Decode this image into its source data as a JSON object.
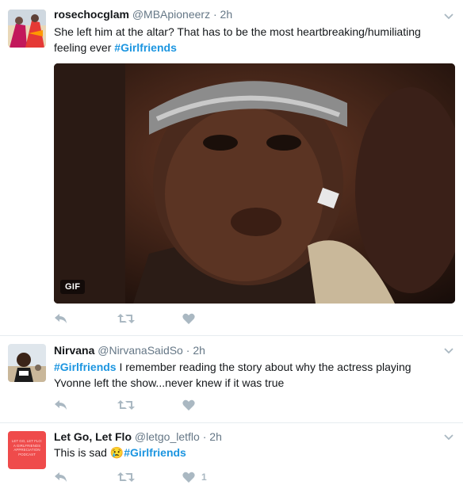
{
  "tweets": [
    {
      "name": "rosechocglam",
      "handle": "@MBApioneerz",
      "dot": "·",
      "time": "2h",
      "text_before": "She left him at the altar? That has to be the most heartbreaking/humiliating feeling ever ",
      "hashtag": "#Girlfriends",
      "text_after": "",
      "media_badge": "GIF",
      "like_count": ""
    },
    {
      "name": "Nirvana",
      "handle": "@NirvanaSaidSo",
      "dot": "·",
      "time": "2h",
      "hashtag": "#Girlfriends",
      "text_after": " I remember reading the story about why the actress playing Yvonne left the show...never knew if it was true",
      "like_count": ""
    },
    {
      "name": "Let Go, Let Flo",
      "handle": "@letgo_letflo",
      "dot": "·",
      "time": "2h",
      "text_before": "This is sad ",
      "emoji": "😢",
      "hashtag": "#Girlfriends",
      "avatar_text": "LET GO, LET FLO: A GIRLFRIENDS APPRECIATION PODCAST",
      "like_count": "1"
    }
  ],
  "icons": {
    "reply": "reply-icon",
    "retweet": "retweet-icon",
    "like": "heart-icon",
    "more": "chevron-down-icon"
  },
  "colors": {
    "hashtag": "#1b95e0",
    "action": "#aab8c2",
    "meta": "#657786",
    "divider": "#e6ecf0"
  }
}
